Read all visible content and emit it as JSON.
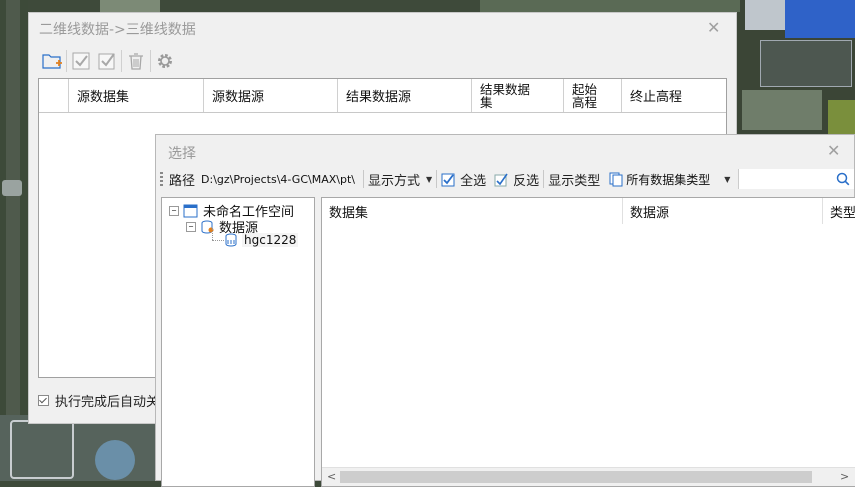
{
  "dialog_main": {
    "title": "二维线数据->三维线数据",
    "columns": [
      "源数据集",
      "源数据源",
      "结果数据源",
      "结果数据集",
      "起始高程",
      "终止高程"
    ],
    "auto_close_label": "执行完成后自动关",
    "auto_close_checked": true,
    "toolbar": [
      "add-dataset-icon",
      "check-all-icon",
      "check-invert-icon",
      "delete-icon",
      "settings-icon"
    ]
  },
  "dialog_select": {
    "title": "选择",
    "toolbar": {
      "path_label": "路径",
      "path_value": "D:\\gz\\Projects\\4-GC\\MAX\\pt\\",
      "display_mode_label": "显示方式",
      "select_all_label": "全选",
      "select_all_checked": true,
      "invert_label": "反选",
      "show_type_label": "显示类型",
      "type_filter_value": "所有数据集类型"
    },
    "tree": {
      "workspace": "未命名工作空间",
      "datasource_group": "数据源",
      "datasource": "hgc1228"
    },
    "list_columns": [
      "数据集",
      "数据源",
      "类型"
    ]
  },
  "colors": {
    "dialog_bg": "#f0f0f0",
    "title_text": "#9a9a9a",
    "accent_blue": "#2a6fc9"
  }
}
